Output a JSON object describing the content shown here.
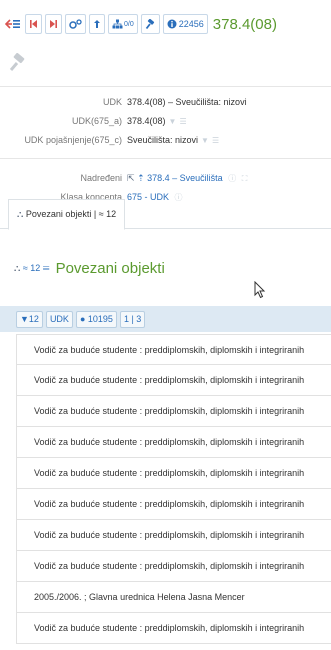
{
  "toolbar": {
    "record_id": "22456",
    "title": "378.4(08)",
    "count_label": "0/0"
  },
  "properties": [
    {
      "label": "UDK",
      "value": "378.4(08) – Sveučilišta: nizovi",
      "icons": false
    },
    {
      "label": "UDK(675_a)",
      "value": "378.4(08)",
      "icons": true
    },
    {
      "label": "UDK pojašnjenje(675_c)",
      "value": "Sveučilišta: nizovi",
      "icons": true
    }
  ],
  "relations": {
    "parent_label": "Nadređeni",
    "parent_value": "378.4 – Sveučilišta",
    "class_label": "Klasa koncepta",
    "class_value": "675 - UDK"
  },
  "tabs": [
    {
      "label": "Povezani objekti | ≈ 12",
      "active": true
    }
  ],
  "section": {
    "count": "≈ 12",
    "title": "Povezani objekti"
  },
  "filterbar": {
    "filter_count": "12",
    "udk_label": "UDK",
    "id_value": "10195",
    "pages": "1 | 3"
  },
  "items": [
    "Vodič za buduće studente : preddiplomskih, diplomskih i integriranih",
    "Vodič za buduće studente : preddiplomskih, diplomskih i integriranih",
    "Vodič za buduće studente : preddiplomskih, diplomskih i integriranih",
    "Vodič za buduće studente : preddiplomskih, diplomskih i integriranih",
    "Vodič za buduće studente : preddiplomskih, diplomskih i integriranih",
    "Vodič za buduće studente : preddiplomskih, diplomskih i integriranih",
    "Vodič za buduće studente : preddiplomskih, diplomskih i integriranih",
    "Vodič za buduće studente : preddiplomskih, diplomskih i integriranih",
    "2005./2006. ; Glavna urednica Helena Jasna Mencer",
    "Vodič za buduće studente : preddiplomskih, diplomskih i integriranih"
  ],
  "colors": {
    "accent": "#2a6ebb",
    "title_green": "#5b9a2f",
    "filterbar_bg": "#dde9f3",
    "danger": "#d9534f"
  }
}
